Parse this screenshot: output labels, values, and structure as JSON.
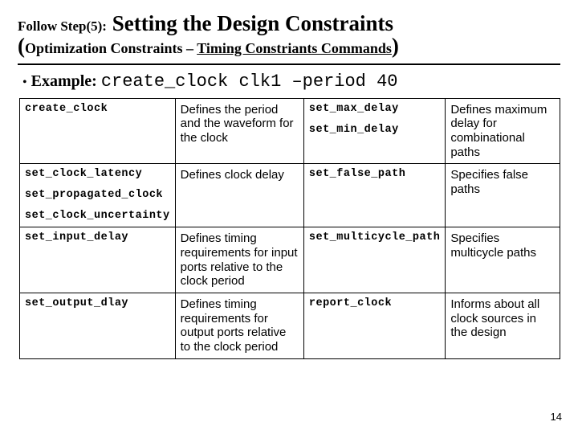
{
  "title": {
    "prefix": "Follow Step(5):",
    "main": "Setting the Design Constraints",
    "paren_open": "(",
    "sub_a": "Optimization Constraints – ",
    "sub_b_underlined": "Timing Constriants Commands",
    "paren_close": ")"
  },
  "example": {
    "bullet": "•",
    "label": "Example:",
    "code": "create_clock clk1 –period 40"
  },
  "rows": [
    {
      "cmd_a": "create_clock",
      "desc_a": "Defines the period and the waveform for the clock",
      "cmd_b1": "set_max_delay",
      "cmd_b2": "set_min_delay",
      "desc_b": "Defines maximum delay for combinational paths"
    },
    {
      "cmd_a1": "set_clock_latency",
      "cmd_a2": "set_propagated_clock",
      "cmd_a3": "set_clock_uncertainty",
      "desc_a": "Defines clock delay",
      "cmd_b": "set_false_path",
      "desc_b": "Specifies false paths"
    },
    {
      "cmd_a": "set_input_delay",
      "desc_a": "Defines timing requirements for input ports relative to the clock period",
      "cmd_b": "set_multicycle_path",
      "desc_b": "Specifies multicycle paths"
    },
    {
      "cmd_a": "set_output_dlay",
      "desc_a": "Defines timing requirements for output ports relative to the clock period",
      "cmd_b": "report_clock",
      "desc_b": "Informs about all clock sources in the design"
    }
  ],
  "page_number": "14"
}
